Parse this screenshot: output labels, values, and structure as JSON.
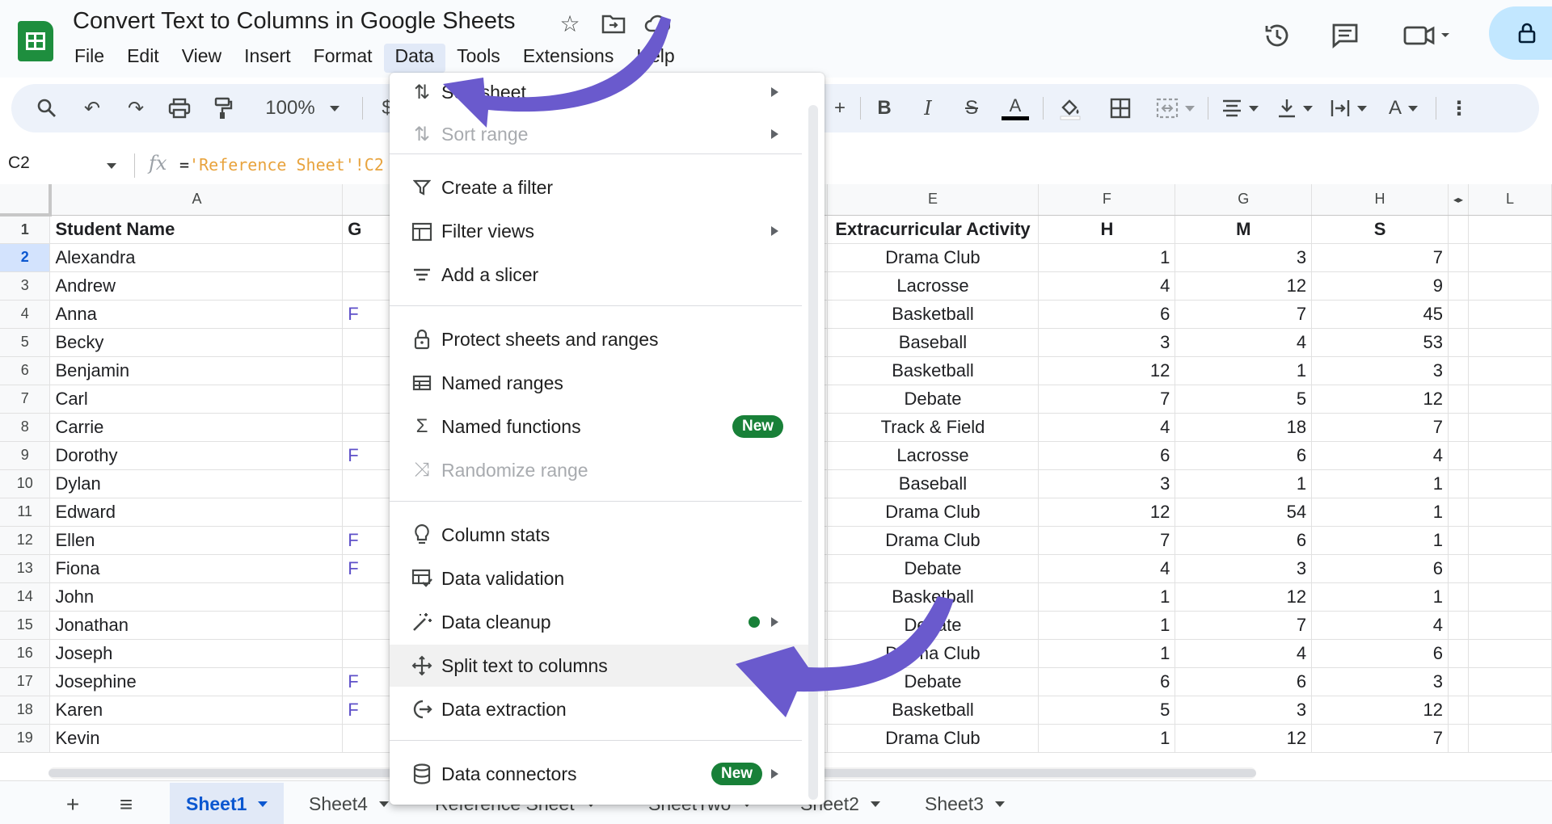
{
  "document": {
    "title": "Convert Text to Columns in Google Sheets"
  },
  "menubar": {
    "items": [
      "File",
      "Edit",
      "View",
      "Insert",
      "Format",
      "Data",
      "Tools",
      "Extensions",
      "Help"
    ],
    "active": "Data"
  },
  "toolbar": {
    "zoom": "100%",
    "currency": "$"
  },
  "formula_bar": {
    "cell_ref": "C2",
    "fx": "fx",
    "formula_eq": "=",
    "formula_ref": "'Reference Sheet'!C2"
  },
  "grid": {
    "columns": [
      "A",
      "",
      "E",
      "F",
      "G",
      "H",
      "",
      "L"
    ],
    "header_row": {
      "row": "1",
      "a": "Student Name",
      "b": "G",
      "e": "Extracurricular Activity",
      "f": "H",
      "g": "M",
      "h": "S"
    },
    "rows": [
      {
        "n": "2",
        "a": "Alexandra",
        "b": "",
        "e": "Drama Club",
        "f": "1",
        "g": "3",
        "h": "7"
      },
      {
        "n": "3",
        "a": "Andrew",
        "b": "",
        "e": "Lacrosse",
        "f": "4",
        "g": "12",
        "h": "9"
      },
      {
        "n": "4",
        "a": "Anna",
        "b": "F",
        "e": "Basketball",
        "f": "6",
        "g": "7",
        "h": "45"
      },
      {
        "n": "5",
        "a": "Becky",
        "b": "",
        "e": "Baseball",
        "f": "3",
        "g": "4",
        "h": "53"
      },
      {
        "n": "6",
        "a": "Benjamin",
        "b": "",
        "e": "Basketball",
        "f": "12",
        "g": "1",
        "h": "3"
      },
      {
        "n": "7",
        "a": "Carl",
        "b": "",
        "e": "Debate",
        "f": "7",
        "g": "5",
        "h": "12"
      },
      {
        "n": "8",
        "a": "Carrie",
        "b": "",
        "e": "Track & Field",
        "f": "4",
        "g": "18",
        "h": "7"
      },
      {
        "n": "9",
        "a": "Dorothy",
        "b": "F",
        "e": "Lacrosse",
        "f": "6",
        "g": "6",
        "h": "4"
      },
      {
        "n": "10",
        "a": "Dylan",
        "b": "",
        "e": "Baseball",
        "f": "3",
        "g": "1",
        "h": "1"
      },
      {
        "n": "11",
        "a": "Edward",
        "b": "",
        "e": "Drama Club",
        "f": "12",
        "g": "54",
        "h": "1"
      },
      {
        "n": "12",
        "a": "Ellen",
        "b": "F",
        "e": "Drama Club",
        "f": "7",
        "g": "6",
        "h": "1"
      },
      {
        "n": "13",
        "a": "Fiona",
        "b": "F",
        "e": "Debate",
        "f": "4",
        "g": "3",
        "h": "6"
      },
      {
        "n": "14",
        "a": "John",
        "b": "",
        "e": "Basketball",
        "f": "1",
        "g": "12",
        "h": "1"
      },
      {
        "n": "15",
        "a": "Jonathan",
        "b": "",
        "e": "Debate",
        "f": "1",
        "g": "7",
        "h": "4"
      },
      {
        "n": "16",
        "a": "Joseph",
        "b": "",
        "e": "Drama Club",
        "f": "1",
        "g": "4",
        "h": "6"
      },
      {
        "n": "17",
        "a": "Josephine",
        "b": "F",
        "e": "Debate",
        "f": "6",
        "g": "6",
        "h": "3"
      },
      {
        "n": "18",
        "a": "Karen",
        "b": "F",
        "e": "Basketball",
        "f": "5",
        "g": "3",
        "h": "12"
      },
      {
        "n": "19",
        "a": "Kevin",
        "b": "",
        "e": "Drama Club",
        "f": "1",
        "g": "12",
        "h": "7"
      }
    ]
  },
  "data_menu": {
    "items": [
      {
        "label": "Sort sheet",
        "icon": "sort-icon",
        "submenu": true,
        "disabled": false
      },
      {
        "label": "Sort range",
        "icon": "sort-range-icon",
        "submenu": true,
        "disabled": true
      },
      {
        "label": "Create a filter",
        "icon": "filter-icon",
        "submenu": false,
        "disabled": false
      },
      {
        "label": "Filter views",
        "icon": "filter-views-icon",
        "submenu": true,
        "disabled": false
      },
      {
        "label": "Add a slicer",
        "icon": "slicer-icon",
        "submenu": false,
        "disabled": false
      },
      {
        "label": "Protect sheets and ranges",
        "icon": "lock-icon",
        "submenu": false,
        "disabled": false
      },
      {
        "label": "Named ranges",
        "icon": "named-ranges-icon",
        "submenu": false,
        "disabled": false
      },
      {
        "label": "Named functions",
        "icon": "sigma-icon",
        "submenu": false,
        "disabled": false,
        "badge": "New"
      },
      {
        "label": "Randomize range",
        "icon": "shuffle-icon",
        "submenu": false,
        "disabled": true
      },
      {
        "label": "Column stats",
        "icon": "lightbulb-icon",
        "submenu": false,
        "disabled": false
      },
      {
        "label": "Data validation",
        "icon": "data-validation-icon",
        "submenu": false,
        "disabled": false
      },
      {
        "label": "Data cleanup",
        "icon": "magic-wand-icon",
        "submenu": true,
        "disabled": false
      },
      {
        "label": "Split text to columns",
        "icon": "split-columns-icon",
        "submenu": false,
        "disabled": false
      },
      {
        "label": "Data extraction",
        "icon": "data-extraction-icon",
        "submenu": false,
        "disabled": false
      },
      {
        "label": "Data connectors",
        "icon": "database-icon",
        "submenu": true,
        "disabled": false,
        "badge": "New"
      }
    ]
  },
  "sheets": {
    "tabs": [
      "Sheet1",
      "Sheet4",
      "Reference Sheet",
      "SheetTwo",
      "Sheet2",
      "Sheet3"
    ],
    "active": "Sheet1"
  },
  "colors": {
    "brand_green": "#1e8e3e",
    "badge_green": "#188038",
    "active_blue": "#0b57d0",
    "annotation_purple": "#6a5acd"
  }
}
